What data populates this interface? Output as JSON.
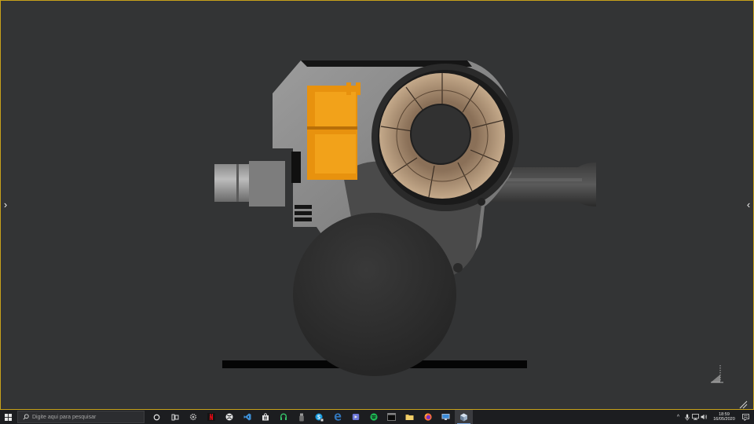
{
  "viewer": {
    "accent_color": "#c8a21a",
    "background_color": "#333435",
    "prev_icon": "chevron-right-icon",
    "next_icon": "chevron-left-icon",
    "prev_glyph": "›",
    "next_glyph": "‹"
  },
  "taskbar": {
    "search_placeholder": "Digite aqui para pesquisar",
    "apps": [
      {
        "name": "cortana",
        "icon": "cortana-circle-icon"
      },
      {
        "name": "task-view",
        "icon": "task-view-icon"
      },
      {
        "name": "settings",
        "icon": "gear-icon"
      },
      {
        "name": "netflix",
        "icon": "netflix-icon"
      },
      {
        "name": "xbox",
        "icon": "xbox-icon"
      },
      {
        "name": "visual-studio",
        "icon": "visual-studio-icon"
      },
      {
        "name": "store",
        "icon": "store-bag-icon"
      },
      {
        "name": "headset",
        "icon": "headset-icon"
      },
      {
        "name": "usb",
        "icon": "usb-icon"
      },
      {
        "name": "skype",
        "icon": "skype-icon"
      },
      {
        "name": "edge",
        "icon": "edge-icon"
      },
      {
        "name": "media",
        "icon": "media-icon"
      },
      {
        "name": "spotify",
        "icon": "spotify-icon"
      },
      {
        "name": "terminal",
        "icon": "terminal-icon"
      },
      {
        "name": "file-explorer",
        "icon": "folder-icon"
      },
      {
        "name": "firefox",
        "icon": "firefox-icon"
      },
      {
        "name": "remote-desktop",
        "icon": "remote-desktop-icon"
      },
      {
        "name": "3d-viewer",
        "icon": "3d-viewer-icon",
        "active": true
      }
    ],
    "tray_chevron": "^",
    "clock_time": "18:59",
    "clock_date": "16/05/2020"
  }
}
